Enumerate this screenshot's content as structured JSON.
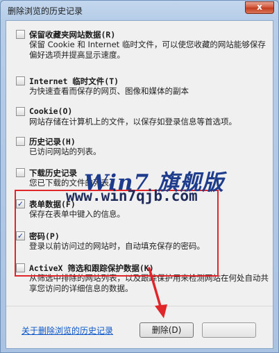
{
  "window": {
    "title": "删除浏览的历史记录",
    "close_label": "x"
  },
  "options": [
    {
      "label": "保留收藏夹网站数据(R)",
      "desc": "保留 Cookie 和 Internet 临时文件，可以使您收藏的网站能够保存偏好选项并提高显示速度。",
      "checked": false
    },
    {
      "label": "Internet 临时文件(T)",
      "desc": "为快速查看而保存的网页、图像和媒体的副本",
      "checked": false
    },
    {
      "label": "Cookie(O)",
      "desc": "网站存储在计算机上的文件，以保存如登录信息等首选项。",
      "checked": false
    },
    {
      "label": "历史记录(H)",
      "desc": "已访问网站的列表。",
      "checked": false
    },
    {
      "label": "下载历史记录",
      "desc": "您已下载的文件的列表。",
      "checked": false
    },
    {
      "label": "表单数据(F)",
      "desc": "保存在表单中键入的信息。",
      "checked": true
    },
    {
      "label": "密码(P)",
      "desc": "登录以前访问过的网站时，自动填充保存的密码。",
      "checked": true
    },
    {
      "label": "ActiveX 筛选和跟踪保护数据(K)",
      "desc": "从筛选中排除的网站列表，以及跟踪保护用来检测网站在何处自动共享您访问的详细信息的数据。",
      "checked": false
    }
  ],
  "watermark": {
    "line1": "Win7 旗舰版",
    "line2": "www.win7qjb.com"
  },
  "footer": {
    "link_text": "关于删除浏览的历史记录",
    "delete_label": "删除(D)"
  },
  "colors": {
    "highlight": "#e0262b",
    "link": "#0b57c8",
    "watermark": "#1e3c8c"
  },
  "icons": {
    "close": "close-icon",
    "arrow": "red-arrow-icon"
  }
}
